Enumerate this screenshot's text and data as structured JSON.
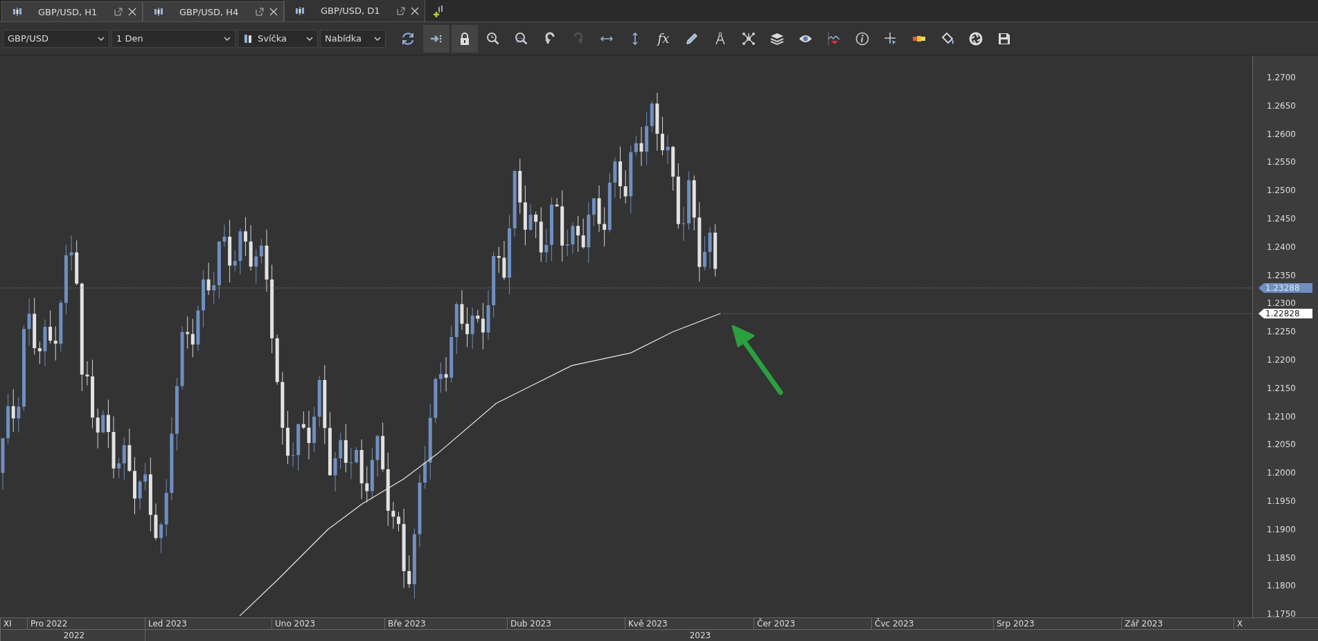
{
  "tabs": [
    {
      "label": "GBP/USD, H1",
      "selected": false
    },
    {
      "label": "GBP/USD, H4",
      "selected": false
    },
    {
      "label": "GBP/USD, D1",
      "selected": true
    }
  ],
  "toolbar": {
    "symbol": "GBP/USD",
    "timeframe": "1 Den",
    "chart_type": "Svíčka",
    "price_source": "Nabídka",
    "buttons": [
      {
        "kind": "refresh",
        "pressed": false,
        "disabled": false
      },
      {
        "kind": "autoscroll",
        "pressed": true,
        "disabled": false
      },
      {
        "kind": "lock",
        "pressed": true,
        "disabled": false
      },
      {
        "kind": "zoom-in",
        "pressed": false,
        "disabled": false
      },
      {
        "kind": "zoom-out",
        "pressed": false,
        "disabled": false
      },
      {
        "kind": "undo",
        "pressed": false,
        "disabled": false
      },
      {
        "kind": "redo",
        "pressed": false,
        "disabled": true
      },
      {
        "kind": "h-arrows",
        "pressed": false,
        "disabled": false
      },
      {
        "kind": "v-arrows",
        "pressed": false,
        "disabled": false
      },
      {
        "kind": "text",
        "label": "fx",
        "pressed": false,
        "disabled": false
      },
      {
        "kind": "pencil",
        "pressed": false,
        "disabled": false
      },
      {
        "kind": "compass",
        "pressed": false,
        "disabled": false
      },
      {
        "kind": "network",
        "pressed": false,
        "disabled": false
      },
      {
        "kind": "layers",
        "pressed": false,
        "disabled": false
      },
      {
        "kind": "eye",
        "pressed": false,
        "disabled": false
      },
      {
        "kind": "wave",
        "pressed": false,
        "disabled": false
      },
      {
        "kind": "info",
        "pressed": false,
        "disabled": false
      },
      {
        "kind": "crosshair",
        "pressed": false,
        "disabled": false
      },
      {
        "kind": "colors",
        "pressed": false,
        "disabled": false
      },
      {
        "kind": "bucket",
        "pressed": false,
        "disabled": false
      },
      {
        "kind": "aperture",
        "pressed": false,
        "disabled": false
      },
      {
        "kind": "save",
        "pressed": false,
        "disabled": false
      }
    ]
  },
  "price_axis": {
    "ticks": [
      "1.2700",
      "1.2650",
      "1.2600",
      "1.2550",
      "1.2500",
      "1.2450",
      "1.2400",
      "1.2350",
      "1.2300",
      "1.2250",
      "1.2200",
      "1.2150",
      "1.2100",
      "1.2050",
      "1.2000",
      "1.1950",
      "1.1900",
      "1.1850",
      "1.1800",
      "1.1750"
    ],
    "markers": [
      {
        "kind": "bid",
        "value": "1.23288"
      },
      {
        "kind": "average",
        "value": "1.22828"
      }
    ]
  },
  "time_axis": {
    "months": [
      "XI",
      "Pro 2022",
      "Led 2023",
      "Uno 2023",
      "Bře 2023",
      "Dub 2023",
      "Kvě 2023",
      "Čer 2023",
      "Čvc 2023",
      "Srp 2023",
      "Zář 2023",
      "X"
    ],
    "years": [
      "2022",
      "2023"
    ]
  }
}
